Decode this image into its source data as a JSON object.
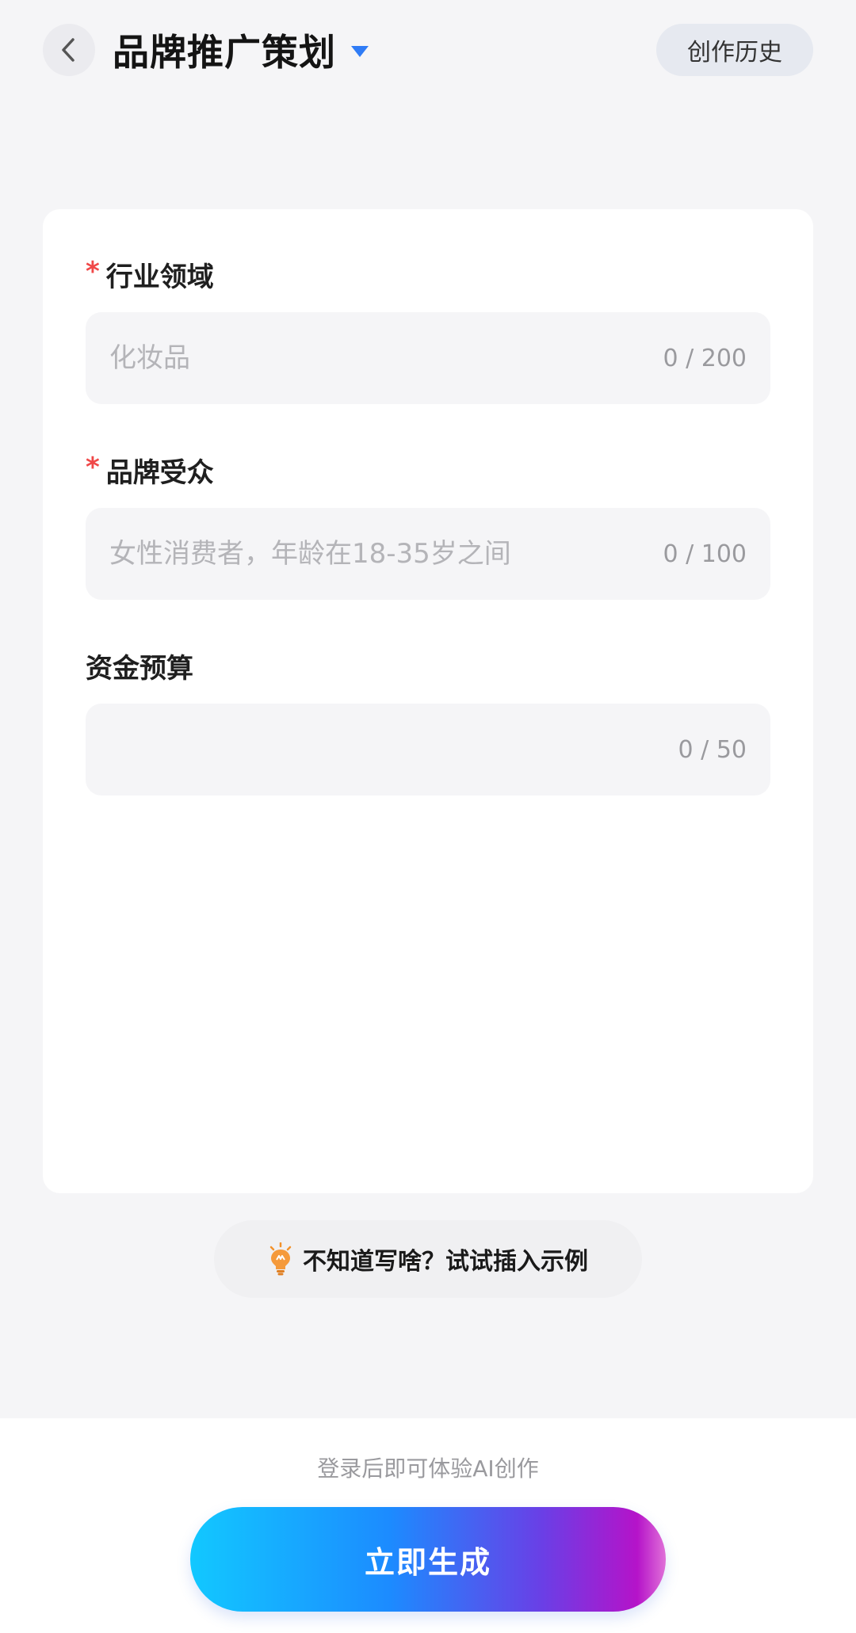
{
  "header": {
    "title": "品牌推广策划",
    "history_label": "创作历史"
  },
  "form": {
    "fields": [
      {
        "label": "行业领域",
        "required": true,
        "placeholder": "化妆品",
        "value": "",
        "counter": "0 / 200"
      },
      {
        "label": "品牌受众",
        "required": true,
        "placeholder": "女性消费者，年龄在18-35岁之间",
        "value": "",
        "counter": "0 / 100"
      },
      {
        "label": "资金预算",
        "required": false,
        "placeholder": "",
        "value": "",
        "counter": "0 / 50"
      }
    ],
    "required_mark": "*"
  },
  "example_hint": "不知道写啥？试试插入示例",
  "footer": {
    "login_tip": "登录后即可体验AI创作",
    "generate_label": "立即生成"
  },
  "colors": {
    "accent_blue": "#1c8bff",
    "required_red": "#f04848",
    "gradient_start": "#12c8ff",
    "gradient_end": "#b513c9"
  },
  "icons": [
    "back-chevron-icon",
    "caret-down-icon",
    "lightbulb-icon"
  ]
}
